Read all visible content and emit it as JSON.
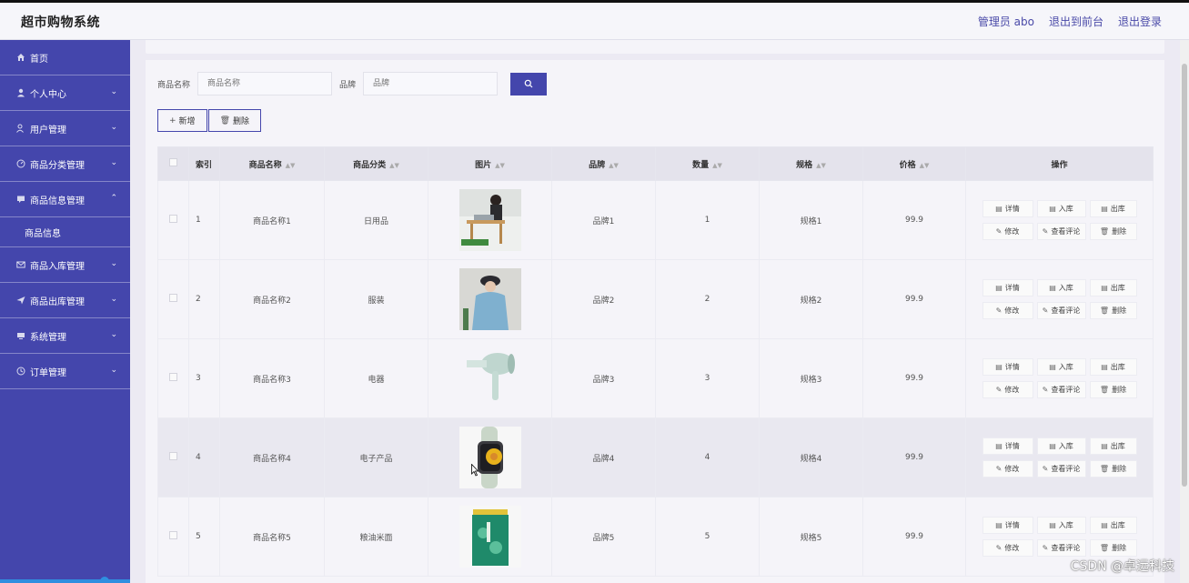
{
  "app": {
    "title": "超市购物系统",
    "user_label": "管理员 abo",
    "front_link": "退出到前台",
    "logout_link": "退出登录"
  },
  "sidebar": {
    "items": [
      {
        "label": "首页",
        "icon": "home-icon"
      },
      {
        "label": "个人中心",
        "icon": "user-icon"
      },
      {
        "label": "用户管理",
        "icon": "users-icon"
      },
      {
        "label": "商品分类管理",
        "icon": "category-icon"
      },
      {
        "label": "商品信息管理",
        "icon": "chat-icon",
        "expanded": true
      },
      {
        "label": "商品信息",
        "sub": true
      },
      {
        "label": "商品入库管理",
        "icon": "mail-icon"
      },
      {
        "label": "商品出库管理",
        "icon": "send-icon"
      },
      {
        "label": "系统管理",
        "icon": "system-icon"
      },
      {
        "label": "订单管理",
        "icon": "clock-icon"
      }
    ]
  },
  "search": {
    "name_label": "商品名称",
    "name_placeholder": "商品名称",
    "brand_label": "品牌",
    "brand_placeholder": "品牌"
  },
  "toolbar": {
    "add_label": "新增",
    "delete_label": "删除"
  },
  "table": {
    "headers": [
      "索引",
      "商品名称",
      "商品分类",
      "图片",
      "品牌",
      "数量",
      "规格",
      "价格",
      "操作"
    ],
    "rows": [
      {
        "index": "1",
        "name": "商品名称1",
        "category": "日用品",
        "brand": "品牌1",
        "qty": "1",
        "spec": "规格1",
        "price": "99.9",
        "image": "laptop-table"
      },
      {
        "index": "2",
        "name": "商品名称2",
        "category": "服装",
        "brand": "品牌2",
        "qty": "2",
        "spec": "规格2",
        "price": "99.9",
        "image": "hoodie"
      },
      {
        "index": "3",
        "name": "商品名称3",
        "category": "电器",
        "brand": "品牌3",
        "qty": "3",
        "spec": "规格3",
        "price": "99.9",
        "image": "hair-dryer"
      },
      {
        "index": "4",
        "name": "商品名称4",
        "category": "电子产品",
        "brand": "品牌4",
        "qty": "4",
        "spec": "规格4",
        "price": "99.9",
        "image": "smartwatch"
      },
      {
        "index": "5",
        "name": "商品名称5",
        "category": "粮油米面",
        "brand": "品牌5",
        "qty": "5",
        "spec": "规格5",
        "price": "99.9",
        "image": "rice-bag"
      }
    ],
    "ops": {
      "detail": "详情",
      "stock_in": "入库",
      "stock_out": "出库",
      "edit": "修改",
      "reviews": "查看评论",
      "delete": "删除"
    }
  },
  "watermark": "CSDN @卓远科技",
  "colors": {
    "primary": "#4446ac",
    "background": "#f5f4f9"
  }
}
